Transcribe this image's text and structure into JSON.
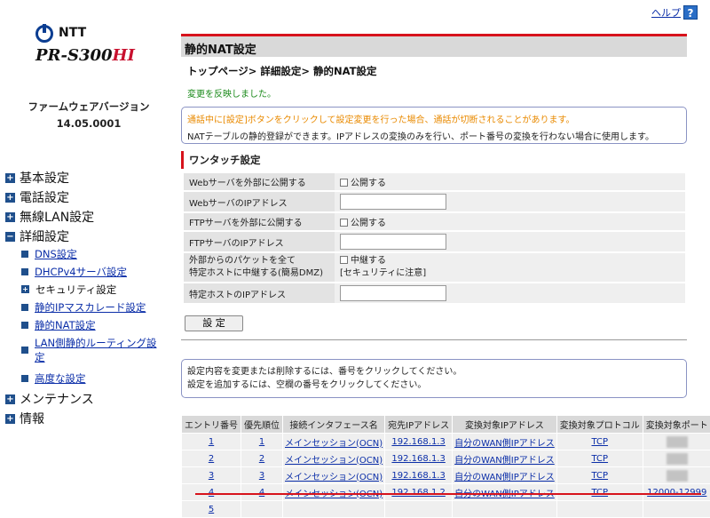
{
  "header": {
    "help_label": "ヘルプ",
    "help_icon": "?"
  },
  "brand": {
    "ntt": "NTT",
    "model_main": "PR-S300",
    "model_suffix": "HI"
  },
  "firmware": {
    "label": "ファームウェアバージョン",
    "version": "14.05.0001"
  },
  "sidebar": {
    "items": [
      {
        "label": "基本設定",
        "marker": "+"
      },
      {
        "label": "電話設定",
        "marker": "+"
      },
      {
        "label": "無線LAN設定",
        "marker": "+"
      },
      {
        "label": "詳細設定",
        "marker": "−"
      },
      {
        "label": "メンテナンス",
        "marker": "+"
      },
      {
        "label": "情報",
        "marker": "+"
      }
    ],
    "sub_items": [
      {
        "label": "DNS設定"
      },
      {
        "label": "DHCPv4サーバ設定"
      },
      {
        "label": "セキュリティ設定"
      },
      {
        "label": "静的IPマスカレード設定"
      },
      {
        "label": "静的NAT設定"
      },
      {
        "label": "LAN側静的ルーティング設",
        "label2": "定"
      },
      {
        "label": "高度な設定"
      }
    ]
  },
  "main": {
    "title": "静的NAT設定",
    "breadcrumb": "トップページ> 詳細設定> 静的NAT設定",
    "applied_message": "変更を反映しました。",
    "notice_warning": "通話中に[設定]ボタンをクリックして設定変更を行った場合、通話が切断されることがあります。",
    "notice_info": "NATテーブルの静的登録ができます。IPアドレスの変換のみを行い、ポート番号の変換を行わない場合に使用します。",
    "onetouch": {
      "title": "ワンタッチ設定",
      "rows": [
        {
          "label": "Webサーバを外部に公開する",
          "checkbox": "公開する"
        },
        {
          "label": "WebサーバのIPアドレス"
        },
        {
          "label": "FTPサーバを外部に公開する",
          "checkbox": "公開する"
        },
        {
          "label": "FTPサーバのIPアドレス"
        },
        {
          "label": "外部からのパケットを全て",
          "label2": "特定ホストに中継する(簡易DMZ)",
          "checkbox": "中継する",
          "note": "[セキュリティに注意]"
        },
        {
          "label": "特定ホストのIPアドレス"
        }
      ]
    },
    "set_button": "設 定",
    "instructions": [
      "設定内容を変更または削除するには、番号をクリックしてください。",
      "設定を追加するには、空欄の番号をクリックしてください。"
    ],
    "nat_table": {
      "headers": [
        "エントリ番号",
        "優先順位",
        "接続インタフェース名",
        "宛先IPアドレス",
        "変換対象IPアドレス",
        "変換対象プロトコル",
        "変換対象ポート"
      ],
      "rows": [
        {
          "entry": "1",
          "priority": "1",
          "iface": "メインセッション(OCN)",
          "dest": "192.168.1.3",
          "target_ip": "自分のWAN側IPアドレス",
          "proto": "TCP",
          "port": ""
        },
        {
          "entry": "2",
          "priority": "2",
          "iface": "メインセッション(OCN)",
          "dest": "192.168.1.3",
          "target_ip": "自分のWAN側IPアドレス",
          "proto": "TCP",
          "port": ""
        },
        {
          "entry": "3",
          "priority": "3",
          "iface": "メインセッション(OCN)",
          "dest": "192.168.1.3",
          "target_ip": "自分のWAN側IPアドレス",
          "proto": "TCP",
          "port": ""
        },
        {
          "entry": "4",
          "priority": "4",
          "iface": "メインセッション(OCN)",
          "dest": "192.168.1.2",
          "target_ip": "自分のWAN側IPアドレス",
          "proto": "TCP",
          "port": "12000-12999"
        },
        {
          "entry": "5",
          "priority": "",
          "iface": "",
          "dest": "",
          "target_ip": "",
          "proto": "",
          "port": ""
        }
      ]
    }
  },
  "colors": {
    "accent_red": "#d7131c",
    "nav_blue": "#1f4f8c",
    "link_blue": "#0b2ea8",
    "warning_orange": "#e98a00",
    "success_green": "#1a8a1a"
  }
}
